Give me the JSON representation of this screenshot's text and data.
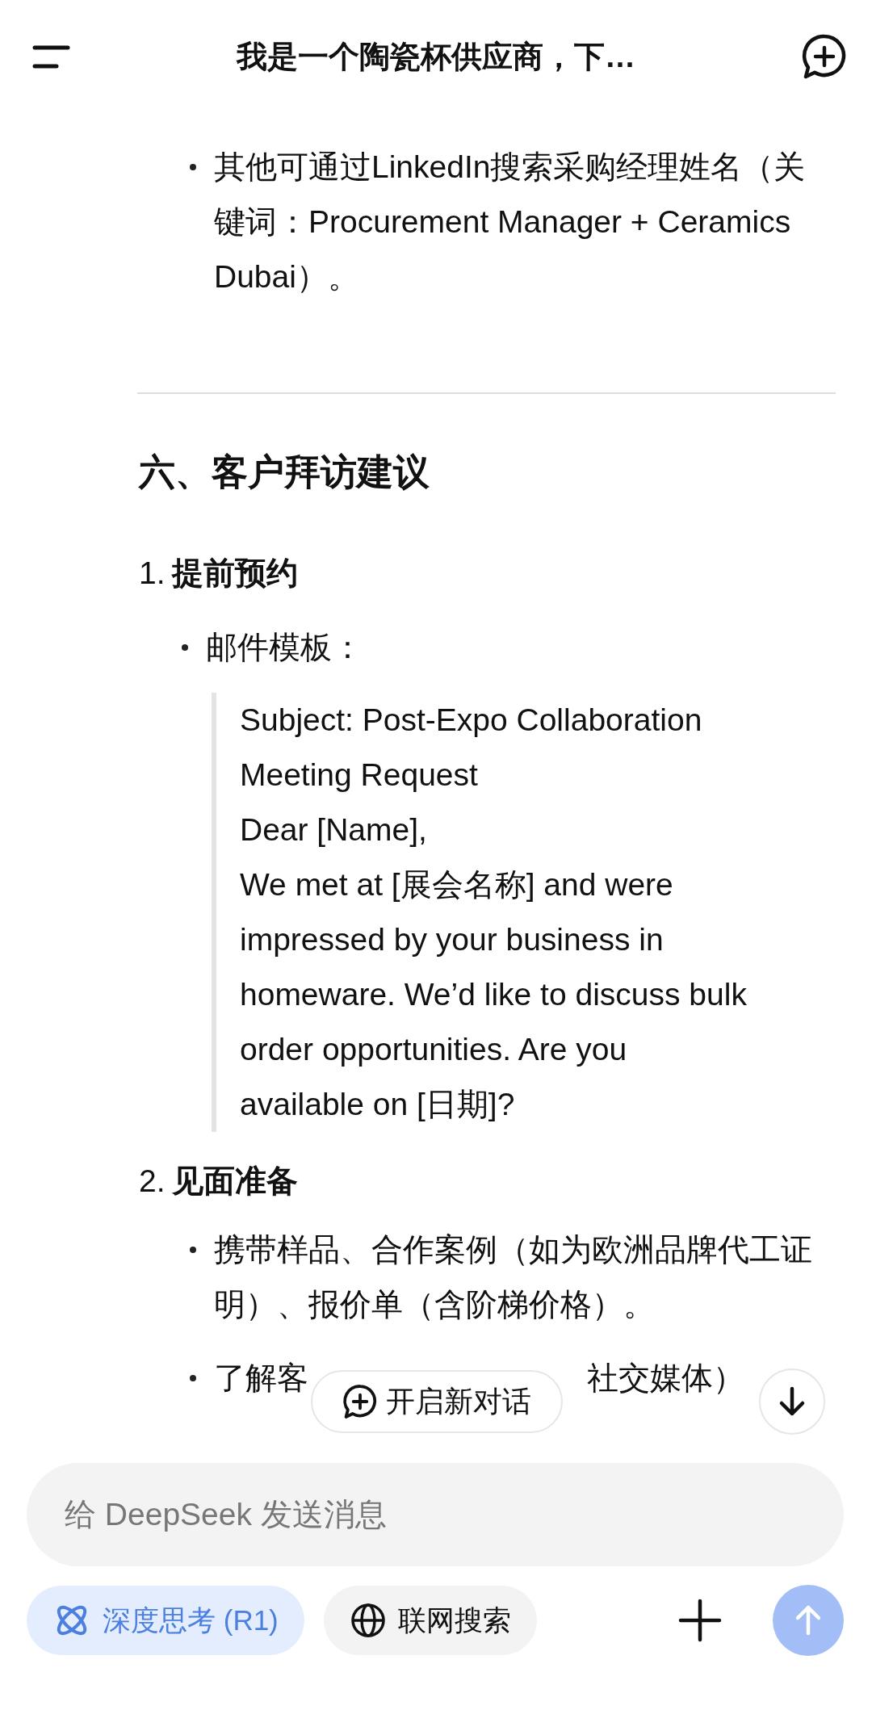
{
  "header": {
    "title": "我是一个陶瓷杯供应商，下…"
  },
  "content": [
    {
      "kind": "bullet",
      "text": "其他可通过LinkedIn搜索采购经理姓名（关键词：Procurement Manager + Ceramics Dubai）。"
    },
    {
      "kind": "divider"
    },
    {
      "kind": "heading",
      "text": "六、客户拜访建议"
    },
    {
      "kind": "numbered",
      "number": "1.",
      "text": "提前预约"
    },
    {
      "kind": "sub-bullet",
      "text": "邮件模板："
    },
    {
      "kind": "quote",
      "lines": [
        "Subject: Post-Expo Collaboration Meeting Request",
        "Dear [Name],",
        "We met at [展会名称] and were impressed by your business in homeware. We’d like to discuss bulk order opportunities. Are you available on [日期]?"
      ]
    },
    {
      "kind": "numbered",
      "number": "2.",
      "text": "见面准备"
    },
    {
      "kind": "bullet",
      "text": "携带样品、合作案例（如为欧洲品牌代工证明）、报价单（含阶梯价格）。"
    },
    {
      "kind": "covered-bullet",
      "parts": [
        "了解客",
        "社交媒体）"
      ]
    }
  ],
  "floating": {
    "new_chat": "开启新对话"
  },
  "composer": {
    "placeholder": "给 DeepSeek 发送消息",
    "toggles": [
      {
        "label": "深度思考 (R1)",
        "selected": true,
        "kind": "think"
      },
      {
        "label": "联网搜索",
        "selected": false,
        "kind": "web"
      }
    ],
    "send_disabled": true
  }
}
